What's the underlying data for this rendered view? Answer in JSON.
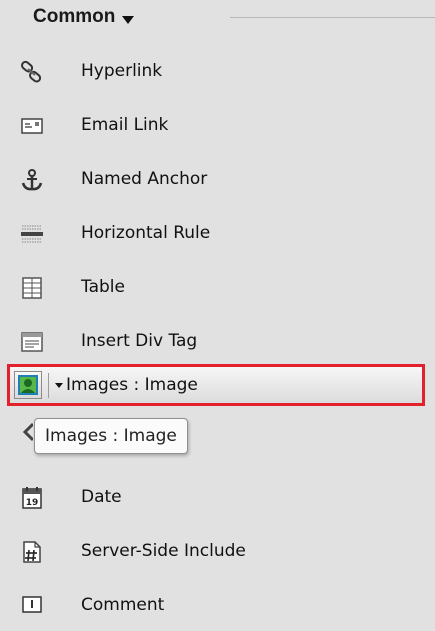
{
  "panel": {
    "category_label": "Common",
    "items": [
      {
        "label": "Hyperlink",
        "icon": "hyperlink-icon"
      },
      {
        "label": "Email Link",
        "icon": "email-link-icon"
      },
      {
        "label": "Named Anchor",
        "icon": "anchor-icon"
      },
      {
        "label": "Horizontal Rule",
        "icon": "horizontal-rule-icon"
      },
      {
        "label": "Table",
        "icon": "table-icon"
      },
      {
        "label": "Insert Div Tag",
        "icon": "div-tag-icon"
      }
    ],
    "selected_button": {
      "label": "Images : Image",
      "icon": "image-icon"
    },
    "tooltip": "Images : Image",
    "items_after": [
      {
        "label": "Date",
        "icon": "calendar-icon",
        "badge": "19"
      },
      {
        "label": "Server-Side Include",
        "icon": "server-side-include-icon"
      },
      {
        "label": "Comment",
        "icon": "comment-icon"
      }
    ]
  },
  "colors": {
    "highlight_border": "#e3202b",
    "panel_bg": "#e1e1e1"
  }
}
